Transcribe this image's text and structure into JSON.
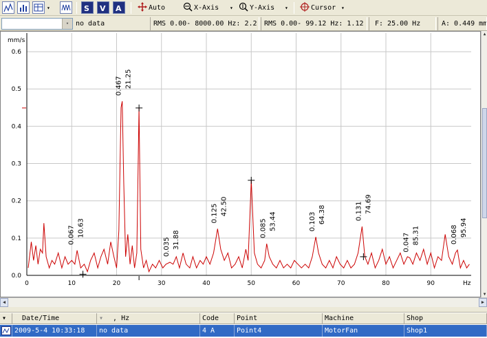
{
  "toolbar": {
    "auto_label": "Auto",
    "xaxis_label": "X-Axis",
    "yaxis_label": "Y-Axis",
    "cursor_label": "Cursor",
    "dropdown_glyph": "▾"
  },
  "status": {
    "combo_value": "",
    "channel_label": "no data",
    "rms_full": "RMS 0.00- 8000.00 Hz: 2.2",
    "rms_band": "RMS 0.00- 99.12 Hz: 1.12",
    "cursor_freq": "F: 25.00 Hz",
    "cursor_amp": "A: 0.449 mm"
  },
  "chart_data": {
    "type": "line",
    "ylabel": "mm/s",
    "xlabel": "Hz",
    "xlim": [
      0,
      99
    ],
    "ylim": [
      0,
      0.65
    ],
    "xticks": [
      0,
      10,
      20,
      30,
      40,
      50,
      60,
      70,
      80,
      90
    ],
    "yticks": [
      0.0,
      0.1,
      0.2,
      0.3,
      0.4,
      0.5,
      0.6
    ],
    "ytick_labels": [
      "0.0",
      "0.1",
      "0.2",
      "0.3",
      "0.4",
      "0.5",
      "0.6"
    ],
    "series_color": "#cc0000",
    "grid": true,
    "x": [
      0.3,
      1,
      1.5,
      2,
      2.5,
      3,
      3.5,
      3.8,
      4.3,
      5,
      5.6,
      6.2,
      7,
      7.8,
      8.5,
      9.2,
      10,
      10.7,
      11.2,
      12,
      12.8,
      13.5,
      14.2,
      15,
      15.8,
      16.5,
      17.2,
      18,
      18.7,
      19.4,
      20,
      20.5,
      21,
      21.25,
      21.6,
      22,
      22.5,
      23,
      23.5,
      24,
      24.5,
      25,
      25.4,
      26,
      26.6,
      27.2,
      28,
      28.7,
      29.5,
      30.3,
      31,
      31.88,
      32.6,
      33.3,
      34,
      34.8,
      35.5,
      36.3,
      37,
      37.8,
      38.6,
      39.3,
      40,
      40.8,
      41.6,
      42.5,
      43.2,
      44,
      44.8,
      45.6,
      46.4,
      47.2,
      48,
      48.8,
      49.3,
      50,
      50.7,
      51.4,
      52.2,
      53,
      53.44,
      54,
      54.8,
      55.6,
      56.4,
      57.2,
      58,
      58.8,
      59.6,
      60.4,
      61.2,
      62,
      62.8,
      63.6,
      64.38,
      65,
      65.8,
      66.6,
      67.4,
      68.2,
      69,
      69.8,
      70.6,
      71.4,
      72.2,
      73,
      73.8,
      74.69,
      75.3,
      76,
      76.8,
      77.6,
      78.4,
      79.2,
      80,
      80.8,
      81.6,
      82.4,
      83.2,
      84,
      84.8,
      85.31,
      86,
      86.8,
      87.6,
      88.4,
      89.2,
      90,
      90.8,
      91.6,
      92.4,
      93.2,
      94,
      94.8,
      95.5,
      95.94,
      96.6,
      97.3,
      98,
      98.6
    ],
    "y": [
      0.02,
      0.09,
      0.04,
      0.08,
      0.03,
      0.07,
      0.06,
      0.14,
      0.05,
      0.02,
      0.04,
      0.03,
      0.06,
      0.02,
      0.05,
      0.03,
      0.04,
      0.03,
      0.067,
      0.02,
      0.03,
      0.01,
      0.04,
      0.06,
      0.02,
      0.05,
      0.07,
      0.03,
      0.09,
      0.05,
      0.02,
      0.12,
      0.45,
      0.467,
      0.25,
      0.05,
      0.11,
      0.03,
      0.08,
      0.02,
      0.06,
      0.449,
      0.07,
      0.02,
      0.04,
      0.01,
      0.03,
      0.02,
      0.04,
      0.02,
      0.03,
      0.035,
      0.03,
      0.05,
      0.02,
      0.06,
      0.03,
      0.02,
      0.05,
      0.02,
      0.04,
      0.03,
      0.05,
      0.03,
      0.06,
      0.125,
      0.07,
      0.04,
      0.06,
      0.02,
      0.03,
      0.05,
      0.02,
      0.07,
      0.04,
      0.255,
      0.06,
      0.03,
      0.02,
      0.04,
      0.085,
      0.05,
      0.03,
      0.02,
      0.04,
      0.02,
      0.03,
      0.02,
      0.04,
      0.03,
      0.02,
      0.03,
      0.02,
      0.05,
      0.103,
      0.06,
      0.03,
      0.02,
      0.04,
      0.02,
      0.05,
      0.03,
      0.02,
      0.04,
      0.02,
      0.03,
      0.06,
      0.131,
      0.05,
      0.03,
      0.06,
      0.02,
      0.04,
      0.07,
      0.03,
      0.05,
      0.02,
      0.04,
      0.06,
      0.03,
      0.05,
      0.047,
      0.03,
      0.06,
      0.04,
      0.07,
      0.03,
      0.06,
      0.02,
      0.05,
      0.04,
      0.11,
      0.05,
      0.03,
      0.06,
      0.068,
      0.02,
      0.04,
      0.02,
      0.03
    ],
    "peak_labels": [
      {
        "freq": 10.63,
        "amp": 0.067,
        "text_amp": "0.067",
        "text_freq": "10.63"
      },
      {
        "freq": 21.25,
        "amp": 0.467,
        "text_amp": "0.467",
        "text_freq": "21.25"
      },
      {
        "freq": 31.88,
        "amp": 0.035,
        "text_amp": "0.035",
        "text_freq": "31.88"
      },
      {
        "freq": 42.5,
        "amp": 0.125,
        "text_amp": "0.125",
        "text_freq": "42.50"
      },
      {
        "freq": 53.44,
        "amp": 0.085,
        "text_amp": "0.085",
        "text_freq": "53.44"
      },
      {
        "freq": 64.38,
        "amp": 0.103,
        "text_amp": "0.103",
        "text_freq": "64.38"
      },
      {
        "freq": 74.69,
        "amp": 0.131,
        "text_amp": "0.131",
        "text_freq": "74.69"
      },
      {
        "freq": 85.31,
        "amp": 0.047,
        "text_amp": "0.047",
        "text_freq": "85.31"
      },
      {
        "freq": 95.94,
        "amp": 0.068,
        "text_amp": "0.068",
        "text_freq": "95.94"
      }
    ],
    "cursor_marks": [
      {
        "x": 12.5,
        "y": 0.003
      },
      {
        "x": 25.0,
        "y": 0.449
      },
      {
        "x": 50.0,
        "y": 0.255
      },
      {
        "x": 75.0,
        "y": 0.05
      }
    ]
  },
  "grid": {
    "headers": [
      "Date/Time",
      ", Hz",
      "Code",
      "Point",
      "Machine",
      "Shop"
    ],
    "row": {
      "datetime": "2009-5-4 10:33:18",
      "hz": "no data",
      "code": "4 A",
      "point": "Point4",
      "machine": "MotorFan",
      "shop": "Shop1"
    }
  }
}
